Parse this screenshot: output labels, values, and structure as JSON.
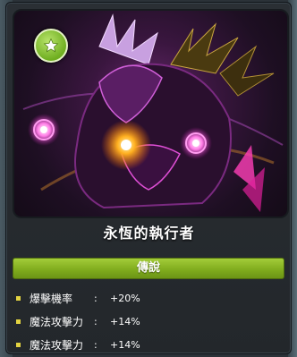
{
  "item": {
    "name": "永恆的執行者",
    "grade": "傳說",
    "stats": [
      {
        "name": "爆擊機率",
        "value": "+20%"
      },
      {
        "name": "魔法攻擊力",
        "value": "+14%"
      },
      {
        "name": "魔法攻擊力",
        "value": "+14%"
      }
    ]
  },
  "colors": {
    "grade_accent": "#8dba27",
    "bullet": "#e3d341"
  },
  "icons": {
    "badge": "star-icon"
  }
}
